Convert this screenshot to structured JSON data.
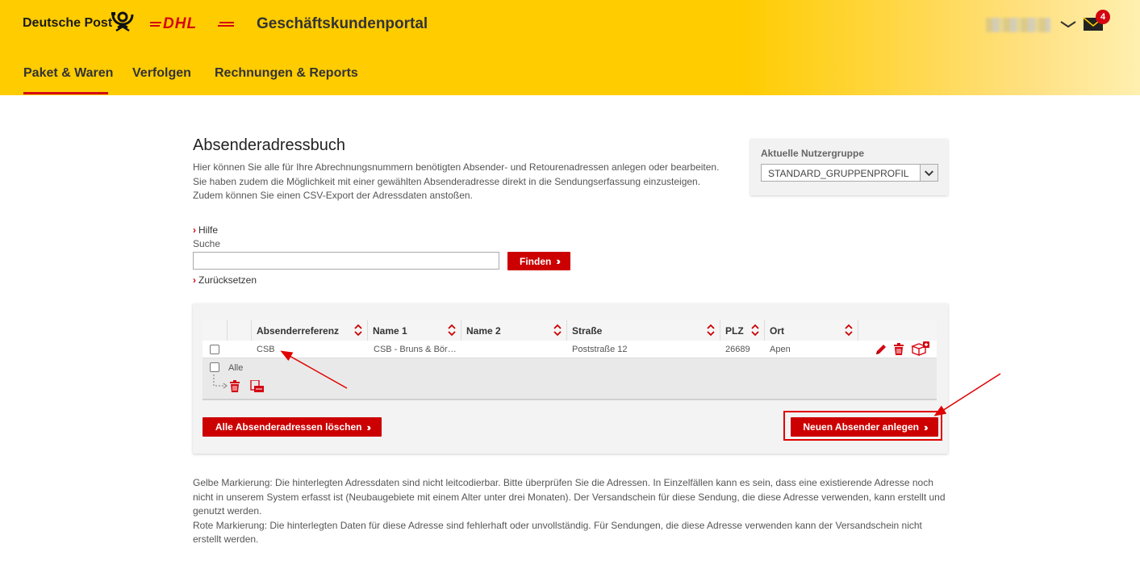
{
  "header": {
    "brand": "Deutsche Post",
    "partner_logo": "DHL",
    "portal_title": "Geschäftskundenportal",
    "notification_count": "4",
    "icons": [
      "posthorn-icon",
      "chevron-down-icon",
      "mail-icon"
    ]
  },
  "nav": {
    "items": [
      {
        "label": "Paket & Waren",
        "active": true
      },
      {
        "label": "Verfolgen",
        "active": false
      },
      {
        "label": "Rechnungen & Reports",
        "active": false
      }
    ]
  },
  "main": {
    "title": "Absenderadressbuch",
    "intro_line1": "Hier können Sie alle für Ihre Abrechnungsnummern benötigten Absender- und Retourenadressen anlegen oder bearbeiten. Sie haben zudem die Möglichkeit mit einer gewählten Absenderadresse direkt in die Sendungserfassung einzusteigen.",
    "intro_line2": "Zudem können Sie einen CSV-Export der Adressdaten anstoßen.",
    "help_link": "Hilfe",
    "search_label": "Suche",
    "search_value": "",
    "find_button": "Finden",
    "reset_link": "Zurücksetzen"
  },
  "usergroup": {
    "label": "Aktuelle Nutzergruppe",
    "selected": "STANDARD_GRUPPENPROFIL"
  },
  "table": {
    "columns": [
      "Absenderreferenz",
      "Name 1",
      "Name 2",
      "Straße",
      "PLZ",
      "Ort"
    ],
    "rows": [
      {
        "ref": "CSB",
        "name1": "CSB - Bruns & Bör…",
        "name2": "",
        "street": "Poststraße 12",
        "plz": "26689",
        "city": "Apen"
      }
    ],
    "select_all_label": "Alle"
  },
  "actions": {
    "delete_all": "Alle Absenderadressen löschen",
    "new_sender": "Neuen Absender anlegen"
  },
  "footnote": {
    "yellow": "Gelbe Markierung: Die hinterlegten Adressdaten sind nicht leitcodierbar. Bitte überprüfen Sie die Adressen. In Einzelfällen kann es sein, dass eine existierende Adresse noch nicht in unserem System erfasst ist (Neubaugebiete mit einem Alter unter drei Monaten). Der Versandschein für diese Sendung, die diese Adresse verwenden, kann erstellt und genutzt werden.",
    "red": "Rote Markierung: Die hinterlegten Daten für diese Adresse sind fehlerhaft oder unvollständig. Für Sendungen, die diese Adresse verwenden kann der Versandschein nicht erstellt werden."
  },
  "colors": {
    "header_yellow": "#ffcc00",
    "accent_red": "#d40511",
    "button_red": "#cc0000"
  }
}
